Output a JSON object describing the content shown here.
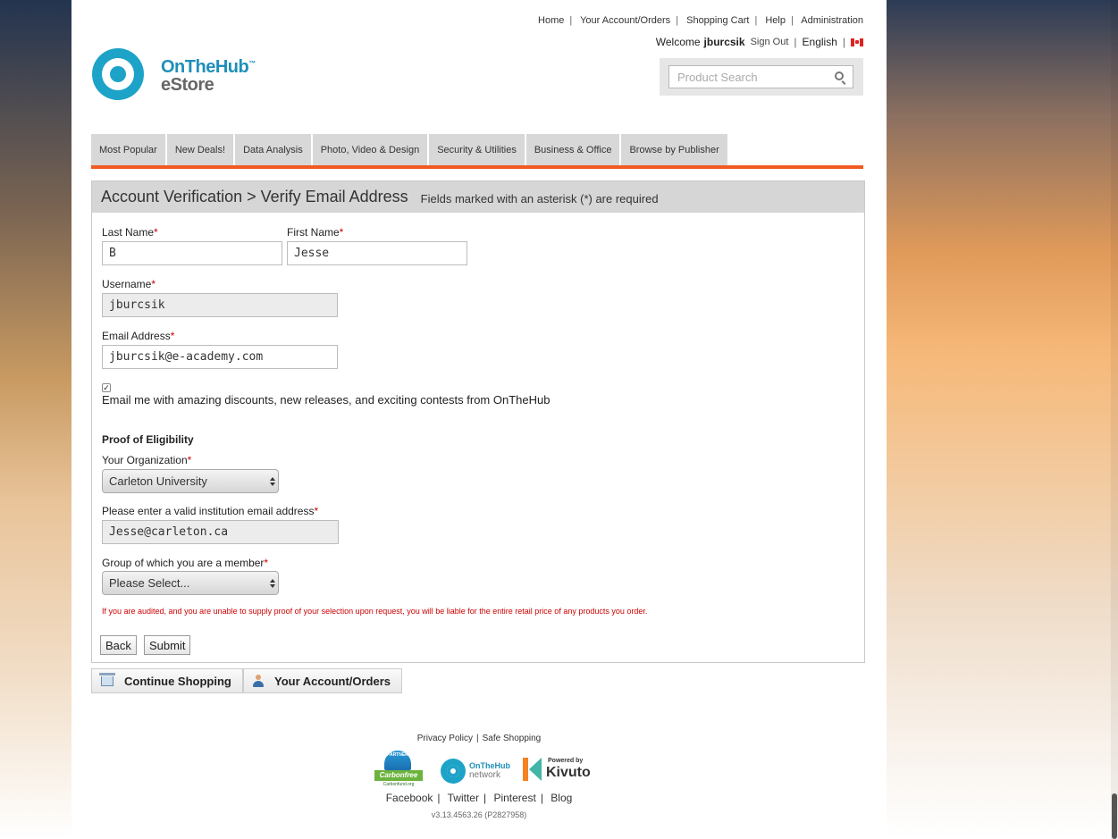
{
  "header": {
    "top_links": [
      "Home",
      "Your Account/Orders",
      "Shopping Cart",
      "Help",
      "Administration"
    ],
    "welcome_label": "Welcome",
    "username": "jburcsik",
    "sign_out": "Sign Out",
    "language": "English",
    "search_placeholder": "Product Search"
  },
  "logo": {
    "line1": "OnTheHub",
    "tm": "™",
    "line2": "eStore"
  },
  "nav": {
    "items": [
      "Most Popular",
      "New Deals!",
      "Data Analysis",
      "Photo, Video & Design",
      "Security & Utilities",
      "Business & Office",
      "Browse by Publisher"
    ]
  },
  "form": {
    "title": "Account Verification > Verify Email Address",
    "note": "Fields marked with an asterisk (*) are required",
    "asterisk": "*",
    "last_name_label": "Last Name",
    "last_name_value": "B",
    "first_name_label": "First Name",
    "first_name_value": "Jesse",
    "username_label": "Username",
    "username_value": "jburcsik",
    "email_label": "Email Address",
    "email_value": "jburcsik@e-academy.com",
    "newsletter_checked": true,
    "newsletter_label": "Email me with amazing discounts, new releases, and exciting contests from OnTheHub",
    "eligibility_heading": "Proof of Eligibility",
    "organization_label": "Your Organization",
    "organization_value": "Carleton University",
    "institution_email_label": "Please enter a valid institution email address",
    "institution_email_value": "Jesse@carleton.ca",
    "group_label": "Group of which you are a member",
    "group_value": "Please Select...",
    "warning": "If you are audited, and you are unable to supply proof of your selection upon request, you will be liable for the entire retail price of any products you order.",
    "back_button": "Back",
    "submit_button": "Submit"
  },
  "bottom_buttons": {
    "continue_shopping": "Continue Shopping",
    "account_orders": "Your Account/Orders"
  },
  "footer": {
    "privacy": "Privacy Policy",
    "safe_shopping": "Safe Shopping",
    "carbonfree_top": "PARTNER",
    "carbonfree": "Carbonfree",
    "carbonfund": "Carbonfund.org",
    "network_name": "OnTheHub",
    "network_sub": "network",
    "powered_by": "Powered by",
    "kivuto": "Kivuto",
    "social": [
      "Facebook",
      "Twitter",
      "Pinterest",
      "Blog"
    ],
    "version": "v3.13.4563.26 (P2827958)"
  }
}
